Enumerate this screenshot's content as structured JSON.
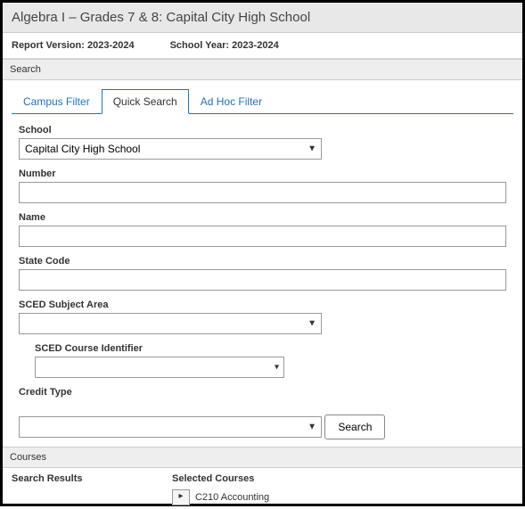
{
  "title": "Algebra I – Grades 7 & 8: Capital City High School",
  "info": {
    "report_version_label": "Report Version:",
    "report_version_value": "2023-2024",
    "school_year_label": "School Year:",
    "school_year_value": "2023-2024"
  },
  "search_section_label": "Search",
  "tabs": {
    "campus_filter": "Campus Filter",
    "quick_search": "Quick Search",
    "ad_hoc_filter": "Ad Hoc Filter"
  },
  "fields": {
    "school_label": "School",
    "school_value": "Capital City High School",
    "number_label": "Number",
    "number_value": "",
    "name_label": "Name",
    "name_value": "",
    "state_code_label": "State Code",
    "state_code_value": "",
    "sced_subject_label": "SCED Subject Area",
    "sced_subject_value": "",
    "sced_course_id_label": "SCED Course Identifier",
    "sced_course_id_value": "",
    "credit_type_label": "Credit Type",
    "credit_type_value": ""
  },
  "search_button": "Search",
  "courses_section_label": "Courses",
  "results": {
    "search_results_label": "Search Results",
    "selected_courses_label": "Selected Courses",
    "move_btn_glyph": "▸",
    "selected_item_1": "C210 Accounting"
  }
}
